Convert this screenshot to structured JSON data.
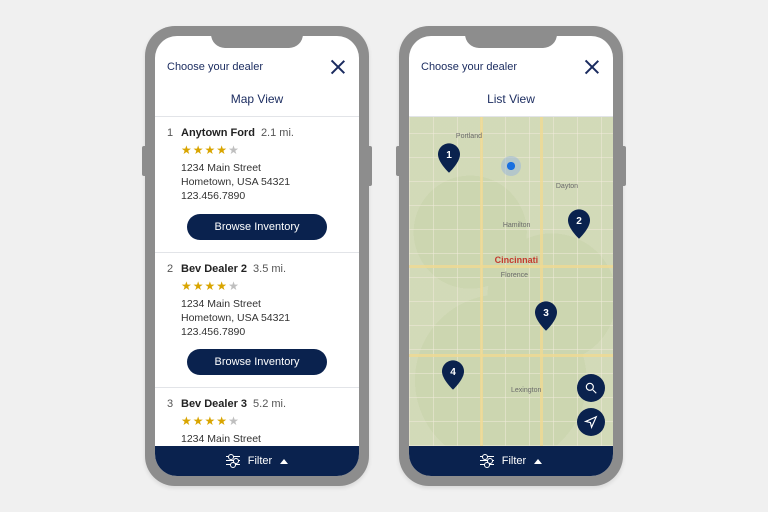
{
  "left": {
    "header_title": "Choose your dealer",
    "tab_label": "Map View",
    "filter_label": "Filter",
    "dealers": [
      {
        "idx": "1",
        "name": "Anytown Ford",
        "distance": "2.1 mi.",
        "rating": 4,
        "address": "1234 Main Street\nHometown, USA 54321\n123.456.7890",
        "cta": "Browse Inventory"
      },
      {
        "idx": "2",
        "name": "Bev Dealer 2",
        "distance": "3.5 mi.",
        "rating": 4,
        "address": "1234 Main Street\nHometown, USA 54321\n123.456.7890",
        "cta": "Browse Inventory"
      },
      {
        "idx": "3",
        "name": "Bev Dealer 3",
        "distance": "5.2 mi.",
        "rating": 4,
        "address": "1234 Main Street",
        "cta": ""
      }
    ]
  },
  "right": {
    "header_title": "Choose your dealer",
    "tab_label": "List View",
    "filter_label": "Filter",
    "city_main": "Cincinnati",
    "city_sub": "Florence",
    "minor_cities": [
      "Dayton",
      "Lexington",
      "Portland",
      "Hamilton"
    ],
    "pins": [
      "1",
      "2",
      "3",
      "4"
    ]
  }
}
